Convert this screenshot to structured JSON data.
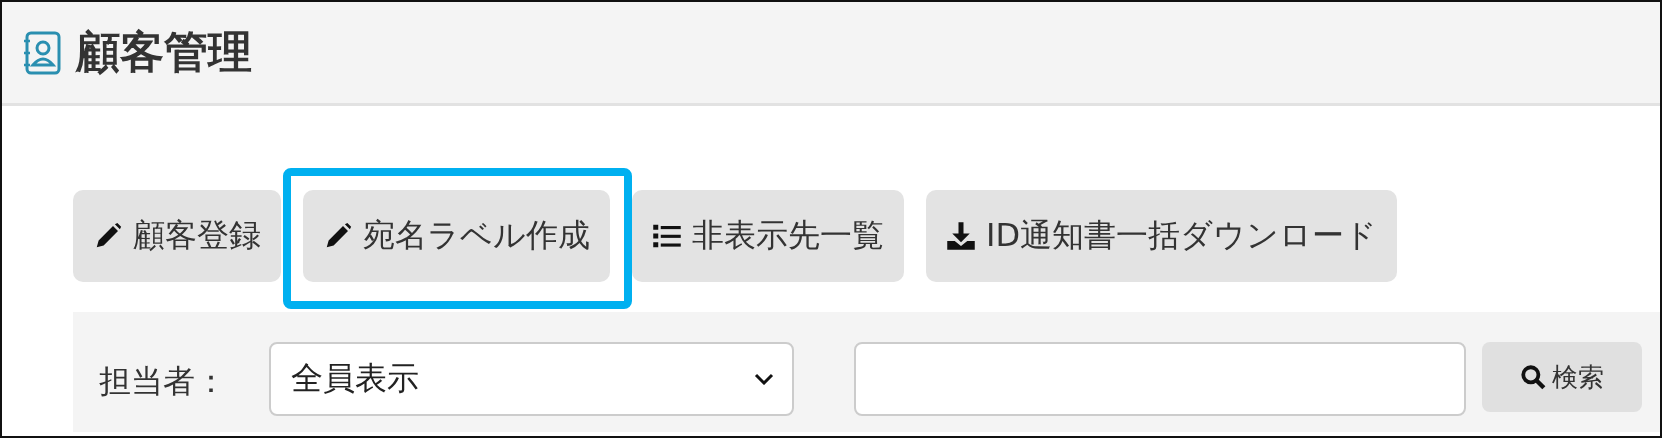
{
  "header": {
    "title": "顧客管理"
  },
  "actions": [
    {
      "kind": "edit",
      "label": "顧客登録",
      "highlighted": false
    },
    {
      "kind": "edit",
      "label": "宛名ラベル作成",
      "highlighted": true
    },
    {
      "kind": "list",
      "label": "非表示先一覧",
      "highlighted": false
    },
    {
      "kind": "download",
      "label": "ID通知書一括ダウンロード",
      "highlighted": false
    }
  ],
  "filter": {
    "staff_label": "担当者：",
    "staff_value": "全員表示",
    "search_button": "検索"
  }
}
